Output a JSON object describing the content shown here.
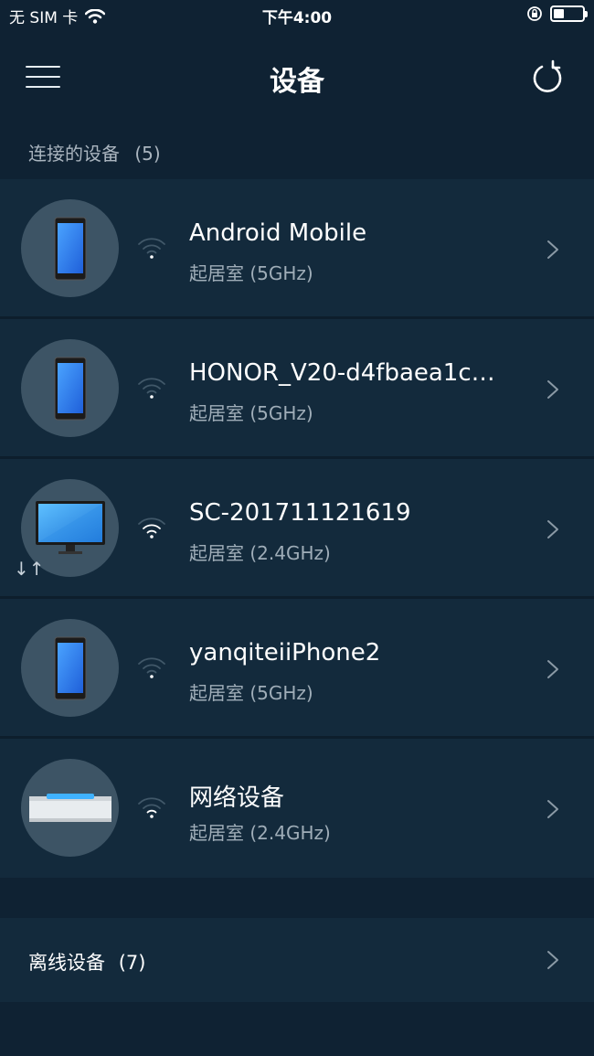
{
  "status_bar": {
    "carrier": "无 SIM 卡",
    "time": "下午4:00",
    "battery_level": 0.35
  },
  "nav": {
    "title": "设备"
  },
  "connected_section": {
    "label": "连接的设备",
    "count": "(5)"
  },
  "devices": [
    {
      "name": "Android Mobile",
      "location": "起居室 (5GHz)",
      "icon": "phone-icon"
    },
    {
      "name": "HONOR_V20-d4fbaea1c…",
      "location": "起居室 (5GHz)",
      "icon": "phone-icon"
    },
    {
      "name": "SC-201711121619",
      "location": "起居室 (2.4GHz)",
      "icon": "monitor-icon",
      "transfer": "↓↑"
    },
    {
      "name": "yanqiteiiPhone2",
      "location": "起居室 (5GHz)",
      "icon": "phone-icon"
    },
    {
      "name": "网络设备",
      "location": "起居室 (2.4GHz)",
      "icon": "network-box-icon"
    }
  ],
  "offline": {
    "label": "离线设备",
    "count": "(7)"
  }
}
